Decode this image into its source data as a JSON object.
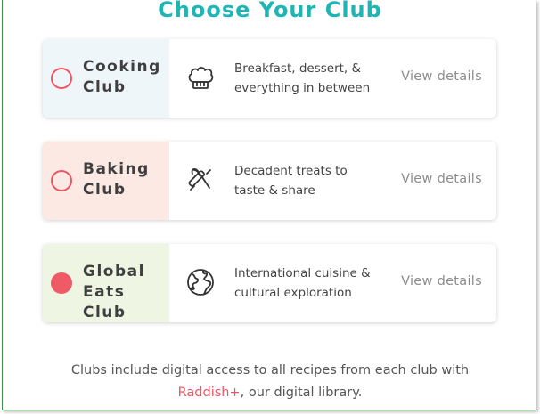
{
  "page": {
    "title": "Choose Your Club"
  },
  "clubs": [
    {
      "name": "Cooking Club",
      "name_line1": "Cooking",
      "name_line2": "Club",
      "icon": "chef-hat-icon",
      "description_line1": "Breakfast, dessert, &",
      "description_line2": "everything in between",
      "details_label": "View details",
      "tint": "#eef6fa",
      "selected": false
    },
    {
      "name": "Baking Club",
      "name_line1": "Baking",
      "name_line2": "Club",
      "icon": "whisk-rolling-pin-icon",
      "description_line1": "Decadent treats to",
      "description_line2": "taste & share",
      "details_label": "View details",
      "tint": "#fce9e4",
      "selected": false
    },
    {
      "name": "Global Eats Club",
      "name_line1": "Global",
      "name_line2": "Eats Club",
      "icon": "globe-icon",
      "description_line1": "International cuisine &",
      "description_line2": "cultural exploration",
      "details_label": "View details",
      "tint": "#eef6e3",
      "selected": true
    }
  ],
  "footer": {
    "text_before": "Clubs include digital access to all recipes from each club with",
    "link_text": "Raddish+",
    "text_after": ", our digital library."
  },
  "colors": {
    "title": "#1fb5b5",
    "accent": "#ef5a67",
    "border": "#3b8f4a"
  }
}
